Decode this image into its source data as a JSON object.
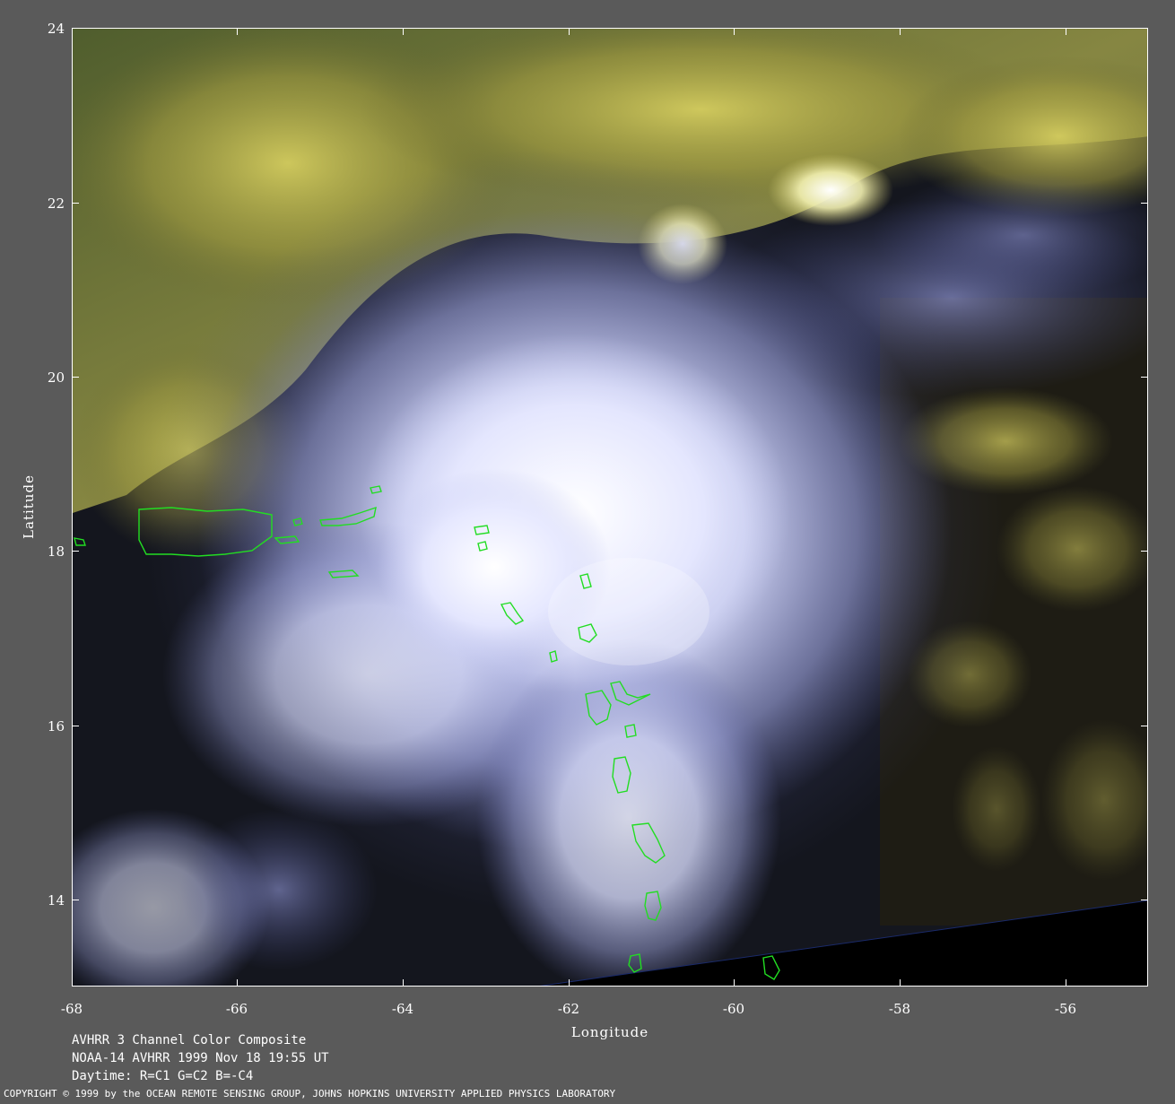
{
  "map": {
    "xlabel": "Longitude",
    "ylabel": "Latitude",
    "lon_ticks": [
      "-68",
      "-66",
      "-64",
      "-62",
      "-60",
      "-58",
      "-56"
    ],
    "lat_ticks": [
      "24",
      "22",
      "20",
      "18",
      "16",
      "14"
    ],
    "lon_range": [
      -68,
      -55
    ],
    "lat_range": [
      13,
      24
    ],
    "coastline_color": "#22dd22",
    "border_color": "#ffffff",
    "background_color": "#5a5a5a",
    "cloud_colors": {
      "high_cloud": "#c8c8f0",
      "low_cloud": "#e8e070",
      "ocean": "#121420",
      "no_data": "#000000"
    }
  },
  "caption": {
    "line1": "AVHRR 3 Channel Color Composite",
    "line2": "NOAA-14 AVHRR 1999 Nov 18 19:55 UT",
    "line3": "Daytime: R=C1 G=C2 B=-C4"
  },
  "copyright": "COPYRIGHT © 1999 by the OCEAN REMOTE SENSING GROUP, JOHNS HOPKINS UNIVERSITY APPLIED PHYSICS LABORATORY"
}
